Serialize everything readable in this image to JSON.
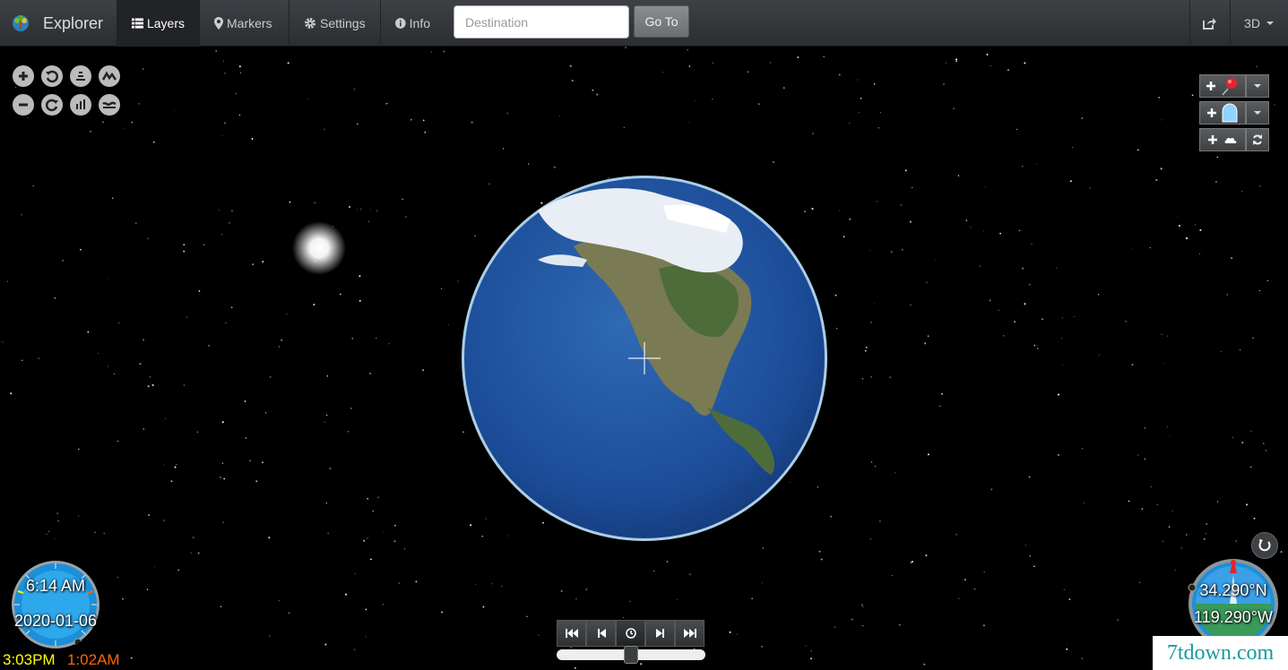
{
  "app": {
    "title": "Explorer"
  },
  "nav": {
    "layers_label": "Layers",
    "markers_label": "Markers",
    "settings_label": "Settings",
    "info_label": "Info"
  },
  "search": {
    "placeholder": "Destination",
    "value": ""
  },
  "goto": {
    "label": "Go To"
  },
  "view_mode": {
    "label": "3D"
  },
  "clock": {
    "time": "6:14 AM",
    "date": "2020-01-06",
    "local_time": "3:03PM",
    "other_time": "1:02AM"
  },
  "compass": {
    "latitude": "34.290°N",
    "longitude": "119.290°W"
  },
  "timeline": {
    "position": 0.5
  },
  "watermark": {
    "text": "7tdown.com"
  },
  "colors": {
    "accent": "#1aa0d8",
    "navbar": "#2f3236",
    "local_time": "#ffff00",
    "other_time": "#ff6600"
  },
  "icons": {
    "layers": "list-icon",
    "markers": "map-marker-icon",
    "settings": "gear-icon",
    "info": "info-icon",
    "share": "share-icon",
    "dropdown": "caret-down-icon"
  }
}
